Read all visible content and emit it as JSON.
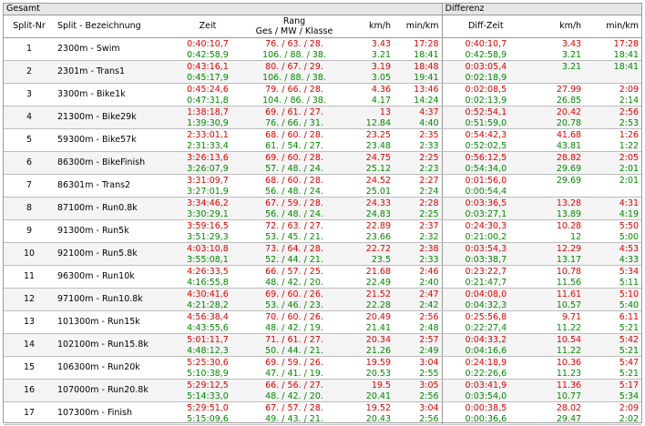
{
  "headers": {
    "gesamt": "Gesamt",
    "differenz": "Differenz",
    "split_nr": "Split-Nr",
    "split_bez": "Split - Bezeichnung",
    "zeit": "Zeit",
    "rang_1": "Rang",
    "rang_2": "Ges / MW / Klasse",
    "kmh": "km/h",
    "minkm": "min/km",
    "diff_zeit": "Diff-Zeit",
    "kmh2": "km/h",
    "minkm2": "min/km"
  },
  "colors": {
    "slower": "#e00000",
    "faster": "#008800"
  },
  "rows": [
    {
      "nr": "1",
      "name": "2300m - Swim",
      "zeit": [
        "0:40:10,7",
        "0:42:58,9"
      ],
      "rang": [
        "76. / 63. / 28.",
        "106. / 88. / 38."
      ],
      "kmh": [
        "3.43",
        "3.21"
      ],
      "minkm": [
        "17:28",
        "18:41"
      ],
      "dz": [
        "0:40:10,7",
        "0:42:58,9"
      ],
      "dkmh": [
        "3.43",
        "3.21"
      ],
      "dminkm": [
        "17:28",
        "18:41"
      ]
    },
    {
      "nr": "2",
      "name": "2301m - Trans1",
      "zeit": [
        "0:43:16,1",
        "0:45:17,9"
      ],
      "rang": [
        "80. / 67. / 29.",
        "106. / 88. / 38."
      ],
      "kmh": [
        "3.19",
        "3.05"
      ],
      "minkm": [
        "18:48",
        "19:41"
      ],
      "dz": [
        "0:03:05,4",
        "0:02:18,9"
      ],
      "dkmh": [
        "",
        "3.21"
      ],
      "dminkm": [
        "",
        "18:41"
      ]
    },
    {
      "nr": "3",
      "name": "3300m - Bike1k",
      "zeit": [
        "0:45:24,6",
        "0:47:31,8"
      ],
      "rang": [
        "79. / 66. / 28.",
        "104. / 86. / 38."
      ],
      "kmh": [
        "4.36",
        "4.17"
      ],
      "minkm": [
        "13:46",
        "14:24"
      ],
      "dz": [
        "0:02:08,5",
        "0:02:13,9"
      ],
      "dkmh": [
        "27.99",
        "26.85"
      ],
      "dminkm": [
        "2:09",
        "2:14"
      ]
    },
    {
      "nr": "4",
      "name": "21300m - Bike29k",
      "zeit": [
        "1:38:18,7",
        "1:39:30,9"
      ],
      "rang": [
        "69. / 61. / 27.",
        "76. / 66. / 31."
      ],
      "kmh": [
        "13",
        "12.84"
      ],
      "minkm": [
        "4:37",
        "4:40"
      ],
      "dz": [
        "0:52:54,1",
        "0:51:59,0"
      ],
      "dkmh": [
        "20.42",
        "20.78"
      ],
      "dminkm": [
        "2:56",
        "2:53"
      ]
    },
    {
      "nr": "5",
      "name": "59300m - Bike57k",
      "zeit": [
        "2:33:01,1",
        "2:31:33,4"
      ],
      "rang": [
        "68. / 60. / 28.",
        "61. / 54. / 27."
      ],
      "kmh": [
        "23.25",
        "23.48"
      ],
      "minkm": [
        "2:35",
        "2:33"
      ],
      "dz": [
        "0:54:42,3",
        "0:52:02,5"
      ],
      "dkmh": [
        "41.68",
        "43.81"
      ],
      "dminkm": [
        "1:26",
        "1:22"
      ]
    },
    {
      "nr": "6",
      "name": "86300m - BikeFinish",
      "zeit": [
        "3:26:13,6",
        "3:26:07,9"
      ],
      "rang": [
        "69. / 60. / 28.",
        "57. / 48. / 24."
      ],
      "kmh": [
        "24.75",
        "25.12"
      ],
      "minkm": [
        "2:25",
        "2:23"
      ],
      "dz": [
        "0:56:12,5",
        "0:54:34,0"
      ],
      "dkmh": [
        "28.82",
        "29.69"
      ],
      "dminkm": [
        "2:05",
        "2:01"
      ]
    },
    {
      "nr": "7",
      "name": "86301m - Trans2",
      "zeit": [
        "3:31:09,7",
        "3:27:01,9"
      ],
      "rang": [
        "68. / 60. / 28.",
        "56. / 48. / 24."
      ],
      "kmh": [
        "24.52",
        "25.01"
      ],
      "minkm": [
        "2:27",
        "2:24"
      ],
      "dz": [
        "0:01:56,0",
        "0:00:54,4"
      ],
      "dkmh": [
        "",
        "29.69"
      ],
      "dminkm": [
        "",
        "2:01"
      ]
    },
    {
      "nr": "8",
      "name": "87100m - Run0.8k",
      "zeit": [
        "3:34:46,2",
        "3:30:29,1"
      ],
      "rang": [
        "67. / 59. / 28.",
        "56. / 48. / 24."
      ],
      "kmh": [
        "24.33",
        "24.83"
      ],
      "minkm": [
        "2:28",
        "2:25"
      ],
      "dz": [
        "0:03:36,5",
        "0:03:27,1"
      ],
      "dkmh": [
        "13.28",
        "13.89"
      ],
      "dminkm": [
        "4:31",
        "4:19"
      ]
    },
    {
      "nr": "9",
      "name": "91300m - Run5k",
      "zeit": [
        "3:59:16,5",
        "3:51:29,3"
      ],
      "rang": [
        "72. / 63. / 27.",
        "53. / 45. / 21."
      ],
      "kmh": [
        "22.89",
        "23.66"
      ],
      "minkm": [
        "2:37",
        "2:32"
      ],
      "dz": [
        "0:24:30,3",
        "0:21:00,2"
      ],
      "dkmh": [
        "10.28",
        "12"
      ],
      "dminkm": [
        "5:50",
        "5:00"
      ]
    },
    {
      "nr": "10",
      "name": "92100m - Run5.8k",
      "zeit": [
        "4:03:10,8",
        "3:55:08,1"
      ],
      "rang": [
        "73. / 64. / 28.",
        "52. / 44. / 21."
      ],
      "kmh": [
        "22.72",
        "23.5"
      ],
      "minkm": [
        "2:38",
        "2:33"
      ],
      "dz": [
        "0:03:54,3",
        "0:03:38,7"
      ],
      "dkmh": [
        "12.29",
        "13.17"
      ],
      "dminkm": [
        "4:53",
        "4:33"
      ]
    },
    {
      "nr": "11",
      "name": "96300m - Run10k",
      "zeit": [
        "4:26:33,5",
        "4:16:55,8"
      ],
      "rang": [
        "66. / 57. / 25.",
        "48. / 42. / 20."
      ],
      "kmh": [
        "21.68",
        "22.49"
      ],
      "minkm": [
        "2:46",
        "2:40"
      ],
      "dz": [
        "0:23:22,7",
        "0:21:47,7"
      ],
      "dkmh": [
        "10.78",
        "11.56"
      ],
      "dminkm": [
        "5:34",
        "5:11"
      ]
    },
    {
      "nr": "12",
      "name": "97100m - Run10.8k",
      "zeit": [
        "4:30:41,6",
        "4:21:28,2"
      ],
      "rang": [
        "69. / 60. / 26.",
        "53. / 46. / 23."
      ],
      "kmh": [
        "21.52",
        "22.28"
      ],
      "minkm": [
        "2:47",
        "2:42"
      ],
      "dz": [
        "0:04:08,0",
        "0:04:32,3"
      ],
      "dkmh": [
        "11.61",
        "10.57"
      ],
      "dminkm": [
        "5:10",
        "5:40"
      ]
    },
    {
      "nr": "13",
      "name": "101300m - Run15k",
      "zeit": [
        "4:56:38,4",
        "4:43:55,6"
      ],
      "rang": [
        "70. / 60. / 26.",
        "48. / 42. / 19."
      ],
      "kmh": [
        "20.49",
        "21.41"
      ],
      "minkm": [
        "2:56",
        "2:48"
      ],
      "dz": [
        "0:25:56,8",
        "0:22:27,4"
      ],
      "dkmh": [
        "9.71",
        "11.22"
      ],
      "dminkm": [
        "6:11",
        "5:21"
      ]
    },
    {
      "nr": "14",
      "name": "102100m - Run15.8k",
      "zeit": [
        "5:01:11,7",
        "4:48:12,3"
      ],
      "rang": [
        "71. / 61. / 27.",
        "50. / 44. / 21."
      ],
      "kmh": [
        "20.34",
        "21.26"
      ],
      "minkm": [
        "2:57",
        "2:49"
      ],
      "dz": [
        "0:04:33,2",
        "0:04:16,6"
      ],
      "dkmh": [
        "10.54",
        "11.22"
      ],
      "dminkm": [
        "5:42",
        "5:21"
      ]
    },
    {
      "nr": "15",
      "name": "106300m - Run20k",
      "zeit": [
        "5:25:30,6",
        "5:10:38,9"
      ],
      "rang": [
        "69. / 59. / 26.",
        "47. / 41. / 19."
      ],
      "kmh": [
        "19.59",
        "20.53"
      ],
      "minkm": [
        "3:04",
        "2:55"
      ],
      "dz": [
        "0:24:18,9",
        "0:22:26,6"
      ],
      "dkmh": [
        "10.36",
        "11.23"
      ],
      "dminkm": [
        "5:47",
        "5:21"
      ]
    },
    {
      "nr": "16",
      "name": "107000m - Run20.8k",
      "zeit": [
        "5:29:12,5",
        "5:14:33,0"
      ],
      "rang": [
        "66. / 56. / 27.",
        "48. / 42. / 20."
      ],
      "kmh": [
        "19.5",
        "20.41"
      ],
      "minkm": [
        "3:05",
        "2:56"
      ],
      "dz": [
        "0:03:41,9",
        "0:03:54,0"
      ],
      "dkmh": [
        "11.36",
        "10.77"
      ],
      "dminkm": [
        "5:17",
        "5:34"
      ]
    },
    {
      "nr": "17",
      "name": "107300m - Finish",
      "zeit": [
        "5:29:51,0",
        "5:15:09,6"
      ],
      "rang": [
        "67. / 57. / 28.",
        "49. / 43. / 21."
      ],
      "kmh": [
        "19.52",
        "20.43"
      ],
      "minkm": [
        "3:04",
        "2:56"
      ],
      "dz": [
        "0:00:38,5",
        "0:00:36,6"
      ],
      "dkmh": [
        "28.02",
        "29.47"
      ],
      "dminkm": [
        "2:09",
        "2:02"
      ]
    }
  ]
}
